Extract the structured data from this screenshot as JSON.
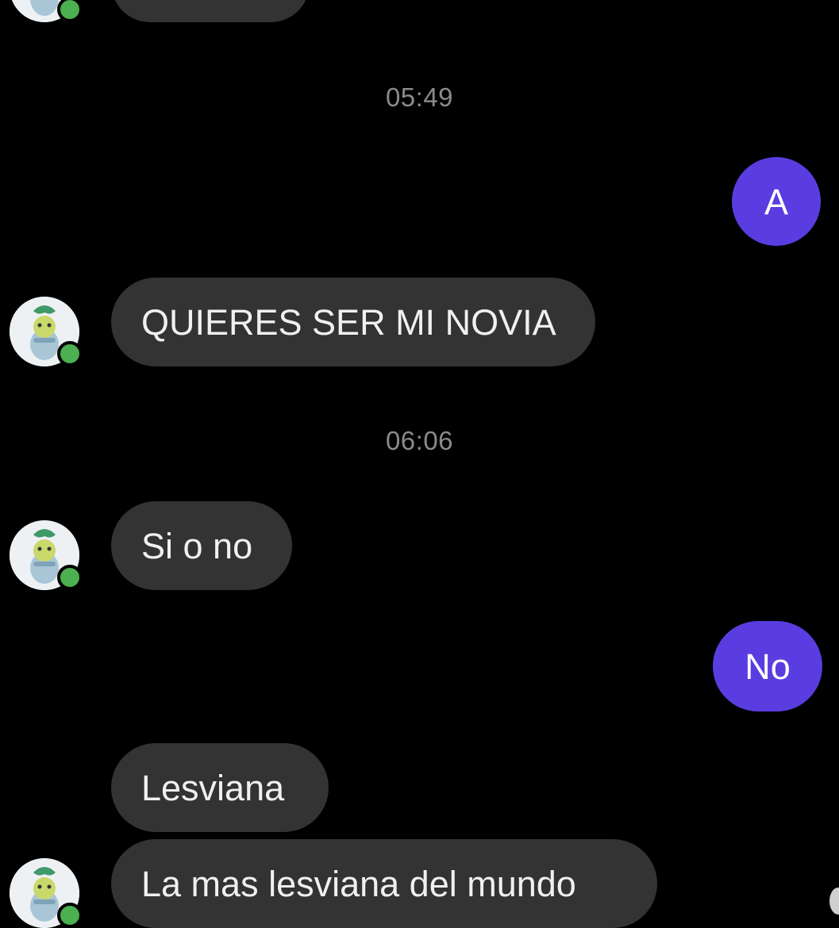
{
  "conversation": {
    "timestamps": [
      "05:49",
      "06:06"
    ],
    "messages": [
      {
        "side": "incoming",
        "text": ""
      },
      {
        "side": "outgoing",
        "text": "A"
      },
      {
        "side": "incoming",
        "text": "QUIERES SER MI NOVIA"
      },
      {
        "side": "incoming",
        "text": "Si o no"
      },
      {
        "side": "outgoing",
        "text": "No"
      },
      {
        "side": "incoming",
        "text": "Lesviana"
      },
      {
        "side": "incoming",
        "text": "La mas lesviana del mundo"
      }
    ]
  },
  "colors": {
    "background": "#000000",
    "incoming_bubble": "#333333",
    "outgoing_bubble": "#5a3de0",
    "presence_dot": "#4caf50",
    "timestamp_text": "#8a8a8a"
  },
  "icons": {
    "avatar": "contact-avatar-icon",
    "presence": "online-status-icon"
  }
}
